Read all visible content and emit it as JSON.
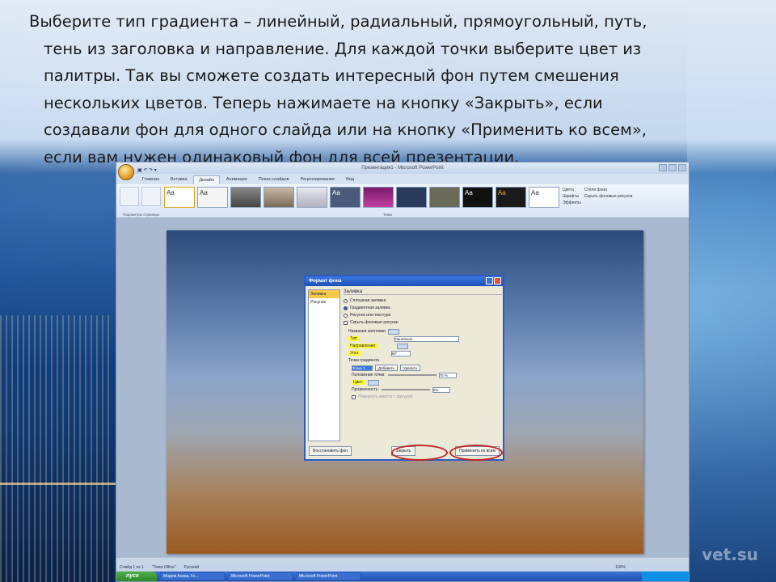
{
  "slide_text": {
    "lines": [
      "Выберите тип градиента – линейный, радиальный, прямоугольный, путь,",
      "тень из заголовка и направление. Для каждой точки выберите цвет из",
      "палитры. Так вы сможете создать интересный фон путем смешения",
      "нескольких цветов. Теперь нажимаете на кнопку «Закрыть», если",
      "создавали фон для одного слайда или на кнопку «Применить ко всем»,",
      "если вам нужен одинаковый фон для всей презентации."
    ]
  },
  "watermark": "vet.su",
  "ppt": {
    "title": "Презентация1 - Microsoft PowerPoint",
    "tabs": [
      "Главная",
      "Вставка",
      "Дизайн",
      "Анимация",
      "Показ слайдов",
      "Рецензирование",
      "Вид"
    ],
    "active_tab": "Дизайн",
    "ribbon": {
      "page_setup_label": "Параметры страницы",
      "themes_label": "Темы",
      "colors": "Цвета",
      "fonts": "Шрифты",
      "effects": "Эффекты",
      "bg_styles": "Стили фона",
      "hide_bg": "Скрыть фоновые рисунки",
      "theme_sample": "Aa"
    },
    "status": [
      "Слайд 1 из 1",
      "\"Тема Office\"",
      "Русский"
    ],
    "zoom": "100%",
    "taskbar": {
      "start": "пуск",
      "items": [
        "Модем Асика, Ге...",
        "Microsoft PowerPoint",
        "Microsoft PowerPoint"
      ]
    }
  },
  "dialog": {
    "title": "Формат фона",
    "nav": [
      "Заливка",
      "Рисунок"
    ],
    "section": "Заливка",
    "options": [
      "Сплошная заливка",
      "Градиентная заливка",
      "Рисунок или текстура",
      "Скрыть фоновые рисунки"
    ],
    "fields": {
      "preset": "Названия заготовки",
      "type": "Тип:",
      "type_value": "Линейный",
      "direction": "Направление:",
      "angle": "Угол:",
      "angle_value": "90°",
      "stops": "Точки градиента",
      "stop_value": "Точка 1",
      "add": "Добавить",
      "remove": "Удалить",
      "position": "Положение точки:",
      "position_value": "75 %",
      "color": "Цвет:",
      "transparency": "Прозрачность:",
      "transparency_value": "0%",
      "rotate": "Повернуть вместе с фигурой"
    },
    "buttons": {
      "reset": "Восстановить фон",
      "close": "Закрыть",
      "apply_all": "Применить ко всем"
    }
  }
}
